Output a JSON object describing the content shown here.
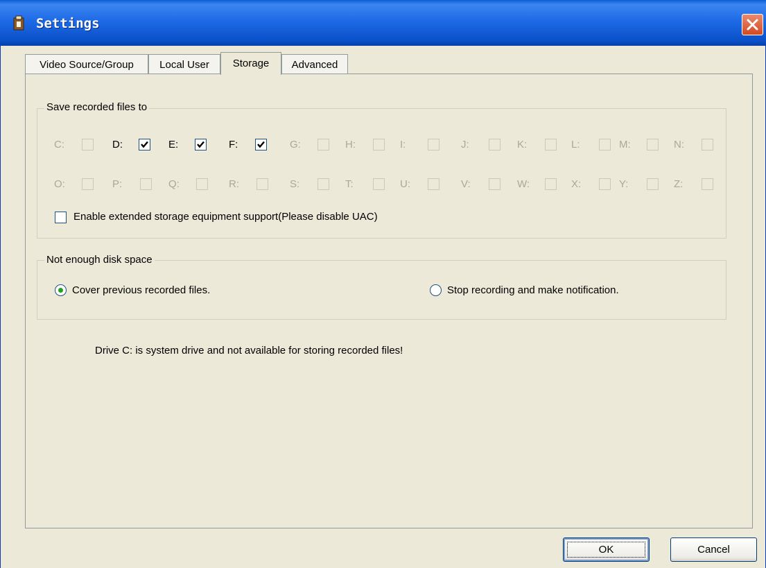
{
  "window": {
    "title": "Settings"
  },
  "tabs": [
    {
      "label": "Video Source/Group",
      "active": false
    },
    {
      "label": "Local User",
      "active": false
    },
    {
      "label": "Storage",
      "active": true
    },
    {
      "label": "Advanced",
      "active": false
    }
  ],
  "save_group": {
    "legend": "Save recorded files to",
    "drives_row1": [
      {
        "label": "C:",
        "checked": false,
        "enabled": false
      },
      {
        "label": "D:",
        "checked": true,
        "enabled": true
      },
      {
        "label": "E:",
        "checked": true,
        "enabled": true
      },
      {
        "label": "F:",
        "checked": true,
        "enabled": true
      },
      {
        "label": "G:",
        "checked": false,
        "enabled": false
      },
      {
        "label": "H:",
        "checked": false,
        "enabled": false
      },
      {
        "label": "I:",
        "checked": false,
        "enabled": false
      },
      {
        "label": "J:",
        "checked": false,
        "enabled": false
      },
      {
        "label": "K:",
        "checked": false,
        "enabled": false
      },
      {
        "label": "L:",
        "checked": false,
        "enabled": false
      },
      {
        "label": "M:",
        "checked": false,
        "enabled": false
      },
      {
        "label": "N:",
        "checked": false,
        "enabled": false
      }
    ],
    "drives_row2": [
      {
        "label": "O:",
        "checked": false,
        "enabled": false
      },
      {
        "label": "P:",
        "checked": false,
        "enabled": false
      },
      {
        "label": "Q:",
        "checked": false,
        "enabled": false
      },
      {
        "label": "R:",
        "checked": false,
        "enabled": false
      },
      {
        "label": "S:",
        "checked": false,
        "enabled": false
      },
      {
        "label": "T:",
        "checked": false,
        "enabled": false
      },
      {
        "label": "U:",
        "checked": false,
        "enabled": false
      },
      {
        "label": "V:",
        "checked": false,
        "enabled": false
      },
      {
        "label": "W:",
        "checked": false,
        "enabled": false
      },
      {
        "label": "X:",
        "checked": false,
        "enabled": false
      },
      {
        "label": "Y:",
        "checked": false,
        "enabled": false
      },
      {
        "label": "Z:",
        "checked": false,
        "enabled": false
      }
    ],
    "extended_label": "Enable extended storage equipment support(Please disable UAC)",
    "extended_checked": false
  },
  "space_group": {
    "legend": "Not enough disk space",
    "option_cover": "Cover previous recorded files.",
    "option_stop": "Stop recording and make notification.",
    "selected": "cover"
  },
  "notice": "Drive C: is system drive and not available for storing recorded files!",
  "buttons": {
    "ok": "OK",
    "cancel": "Cancel"
  }
}
